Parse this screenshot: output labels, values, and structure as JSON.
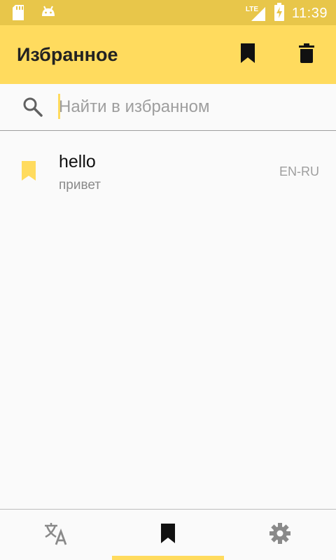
{
  "status_bar": {
    "time": "11:39",
    "network_label": "LTE",
    "icons": [
      "sd-card-icon",
      "android-icon",
      "signal-icon",
      "battery-charging-icon"
    ]
  },
  "app_bar": {
    "title": "Избранное",
    "actions": [
      "bookmark-icon",
      "trash-icon"
    ]
  },
  "search": {
    "placeholder": "Найти в избранном",
    "value": ""
  },
  "favorites": [
    {
      "word": "hello",
      "translation": "привет",
      "lang": "EN-RU"
    }
  ],
  "bottom_nav": {
    "tabs": [
      "translate-icon",
      "bookmark-icon",
      "settings-icon"
    ],
    "active_tab": 1
  },
  "colors": {
    "accent": "#ffdb5e",
    "status_bar": "#e8c64a"
  }
}
